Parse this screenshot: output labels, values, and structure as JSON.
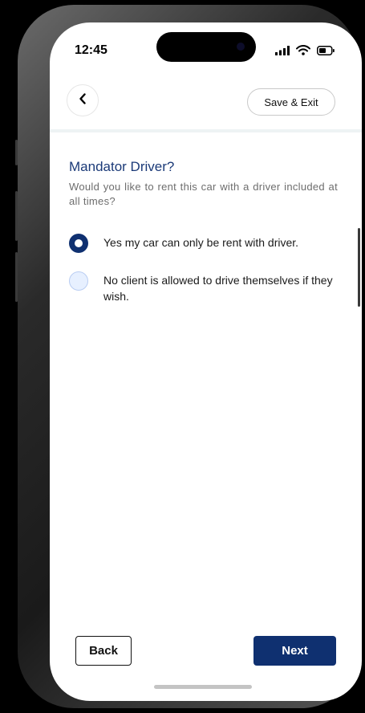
{
  "status_bar": {
    "time": "12:45",
    "icons": [
      "cellular-signal-icon",
      "wifi-icon",
      "battery-icon"
    ]
  },
  "header": {
    "back_icon": "chevron-left-icon",
    "save_exit_label": "Save & Exit"
  },
  "content": {
    "title": "Mandator Driver?",
    "subtitle": "Would you like to rent this car with a driver included at all times?",
    "options": [
      {
        "label": "Yes my car can only be rent with driver.",
        "selected": true
      },
      {
        "label": "No client is allowed to drive themselves if they wish.",
        "selected": false
      }
    ]
  },
  "footer": {
    "back_label": "Back",
    "next_label": "Next"
  },
  "colors": {
    "primary": "#0f3070",
    "title": "#1b3a78",
    "radio_unselected_fill": "#e7f0ff"
  }
}
